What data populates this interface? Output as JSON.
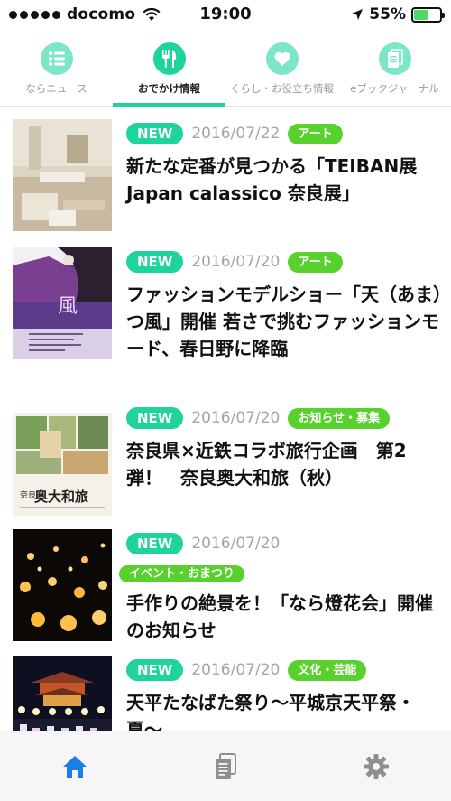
{
  "status_bar": {
    "carrier": "docomo",
    "time": "19:00",
    "battery_percent": "55%",
    "battery_level": 0.55,
    "signal_bars": 5
  },
  "top_tabs": [
    {
      "label": "ならニュース",
      "icon": "list-icon",
      "active": false
    },
    {
      "label": "おでかけ情報",
      "icon": "fork-knife-icon",
      "active": true
    },
    {
      "label": "くらし・お役立ち情報",
      "icon": "heart-icon",
      "active": false
    },
    {
      "label": "eブックジャーナル",
      "icon": "document-icon",
      "active": false
    }
  ],
  "articles": [
    {
      "new_label": "NEW",
      "date": "2016/07/22",
      "category": "アート",
      "title": "新たな定番が見つかる「TEIBAN展 Japan calassico 奈良展」"
    },
    {
      "new_label": "NEW",
      "date": "2016/07/20",
      "category": "アート",
      "title": "ファッションモデルショー「天（あま）つ風」開催 若さで挑むファッションモード、春日野に降臨"
    },
    {
      "new_label": "NEW",
      "date": "2016/07/20",
      "category": "お知らせ・募集",
      "title": "奈良県×近鉄コラボ旅行企画　第2弾！　奈良奥大和旅（秋）"
    },
    {
      "new_label": "NEW",
      "date": "2016/07/20",
      "category": "イベント・おまつり",
      "title": "手作りの絶景を！「なら燈花会」開催のお知らせ"
    },
    {
      "new_label": "NEW",
      "date": "2016/07/20",
      "category": "文化・芸能",
      "title": "天平たなばた祭り〜平城京天平祭・夏〜"
    }
  ],
  "thumb_text": {
    "poster2": "風",
    "poster3_line1": "奈良",
    "poster3_line2": "奥大和旅"
  },
  "bottom_tabs": [
    {
      "icon": "home-icon",
      "active": true
    },
    {
      "icon": "document-icon",
      "active": false
    },
    {
      "icon": "gear-icon",
      "active": false
    }
  ],
  "colors": {
    "accent": "#1fd49a",
    "category": "#58d12e",
    "active_tab_icon": "#1a7de8"
  }
}
